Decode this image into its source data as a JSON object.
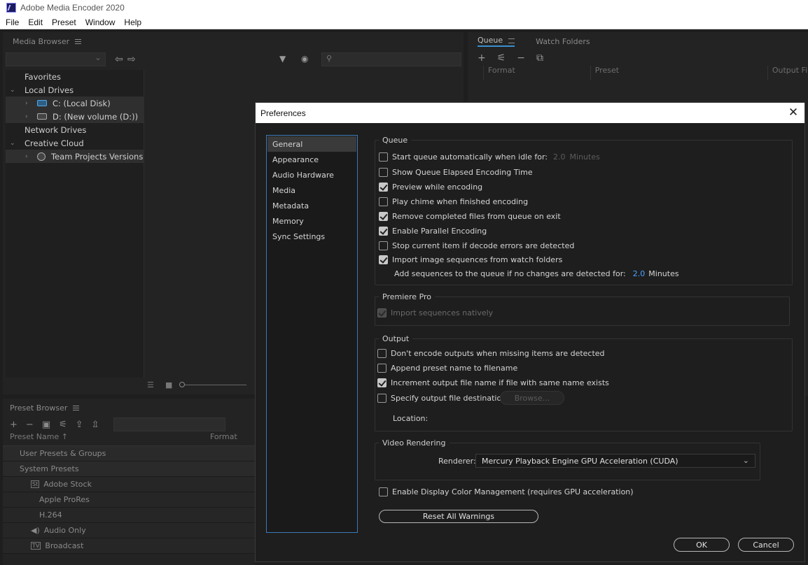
{
  "window": {
    "title": "Adobe Media Encoder 2020"
  },
  "menu": [
    "File",
    "Edit",
    "Preset",
    "Window",
    "Help"
  ],
  "media_browser": {
    "title": "Media Browser",
    "tree": [
      {
        "label": "Favorites",
        "level": 0,
        "expanded": false
      },
      {
        "label": "Local Drives",
        "level": 0,
        "expanded": true
      },
      {
        "label": "C: (Local Disk)",
        "level": 1,
        "icon": "drive-c-icon"
      },
      {
        "label": "D: (New volume (D:))",
        "level": 1,
        "icon": "drive-d-icon"
      },
      {
        "label": "Network Drives",
        "level": 0,
        "expanded": false
      },
      {
        "label": "Creative Cloud",
        "level": 0,
        "expanded": true
      },
      {
        "label": "Team Projects Versions",
        "level": 1,
        "icon": "team-projects-icon"
      }
    ]
  },
  "queue": {
    "tabs": [
      "Queue",
      "Watch Folders"
    ],
    "columns": [
      "Format",
      "Preset",
      "Output File"
    ]
  },
  "preset_browser": {
    "title": "Preset Browser",
    "columns": [
      "Preset Name",
      "Format"
    ],
    "rows": [
      {
        "label": "User Presets & Groups",
        "type": "group"
      },
      {
        "label": "System Presets",
        "type": "group"
      },
      {
        "label": "Adobe Stock",
        "type": "folder",
        "icon": "stock-icon"
      },
      {
        "label": "Apple ProRes",
        "type": "sub"
      },
      {
        "label": "H.264",
        "type": "sub"
      },
      {
        "label": "Audio Only",
        "type": "folder",
        "icon": "speaker-icon"
      },
      {
        "label": "Broadcast",
        "type": "folder",
        "icon": "tv-icon"
      }
    ]
  },
  "preferences": {
    "title": "Preferences",
    "nav": [
      "General",
      "Appearance",
      "Audio Hardware",
      "Media",
      "Metadata",
      "Memory",
      "Sync Settings"
    ],
    "selected_nav": "General",
    "queue": {
      "legend": "Queue",
      "start_auto": {
        "label": "Start queue automatically when idle for:",
        "checked": false,
        "value": "2.0",
        "unit": "Minutes"
      },
      "items": [
        {
          "label": "Show Queue Elapsed Encoding Time",
          "checked": false
        },
        {
          "label": "Preview while encoding",
          "checked": true
        },
        {
          "label": "Play chime when finished encoding",
          "checked": false
        },
        {
          "label": "Remove completed files from queue on exit",
          "checked": true
        },
        {
          "label": "Enable Parallel Encoding",
          "checked": true
        },
        {
          "label": "Stop current item if decode errors are detected",
          "checked": false
        },
        {
          "label": "Import image sequences from watch folders",
          "checked": true
        }
      ],
      "add_seq": {
        "label": "Add sequences to the queue if no changes are detected for:",
        "value": "2.0",
        "unit": "Minutes"
      }
    },
    "premiere": {
      "legend": "Premiere Pro",
      "import_native": {
        "label": "Import sequences natively",
        "checked": true
      }
    },
    "output": {
      "legend": "Output",
      "items": [
        {
          "label": "Don't encode outputs when missing items are detected",
          "checked": false
        },
        {
          "label": "Append preset name to filename",
          "checked": false
        },
        {
          "label": "Increment output file name if file with same name exists",
          "checked": true
        },
        {
          "label": "Specify output file destination:",
          "checked": false
        }
      ],
      "browse": "Browse...",
      "location_label": "Location:"
    },
    "video": {
      "legend": "Video Rendering",
      "renderer_label": "Renderer:",
      "renderer_value": "Mercury Playback Engine GPU Acceleration (CUDA)"
    },
    "color_mgmt": {
      "label": "Enable Display Color Management (requires GPU acceleration)",
      "checked": false
    },
    "reset": "Reset All Warnings",
    "ok": "OK",
    "cancel": "Cancel"
  }
}
